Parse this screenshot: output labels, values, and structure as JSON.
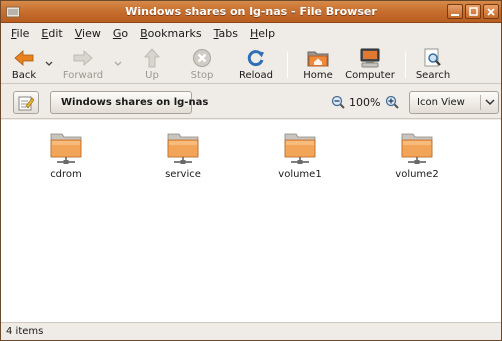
{
  "window": {
    "title": "Windows shares on lg-nas - File Browser"
  },
  "menu": [
    {
      "label": "File",
      "mnemonic": "F"
    },
    {
      "label": "Edit",
      "mnemonic": "E"
    },
    {
      "label": "View",
      "mnemonic": "V"
    },
    {
      "label": "Go",
      "mnemonic": "G"
    },
    {
      "label": "Bookmarks",
      "mnemonic": "B"
    },
    {
      "label": "Tabs",
      "mnemonic": "T"
    },
    {
      "label": "Help",
      "mnemonic": "H"
    }
  ],
  "toolbar": {
    "back": "Back",
    "forward": "Forward",
    "up": "Up",
    "stop": "Stop",
    "reload": "Reload",
    "home": "Home",
    "computer": "Computer",
    "search": "Search"
  },
  "location": {
    "path_button": "Windows shares on lg-nas",
    "zoom": "100%",
    "view_mode": "Icon View"
  },
  "files": [
    {
      "name": "cdrom"
    },
    {
      "name": "service"
    },
    {
      "name": "volume1"
    },
    {
      "name": "volume2"
    }
  ],
  "status": {
    "text": "4 items"
  },
  "colors": {
    "titlebar": "#c8702f",
    "folder": "#f0a050",
    "accent": "#e57b26"
  }
}
